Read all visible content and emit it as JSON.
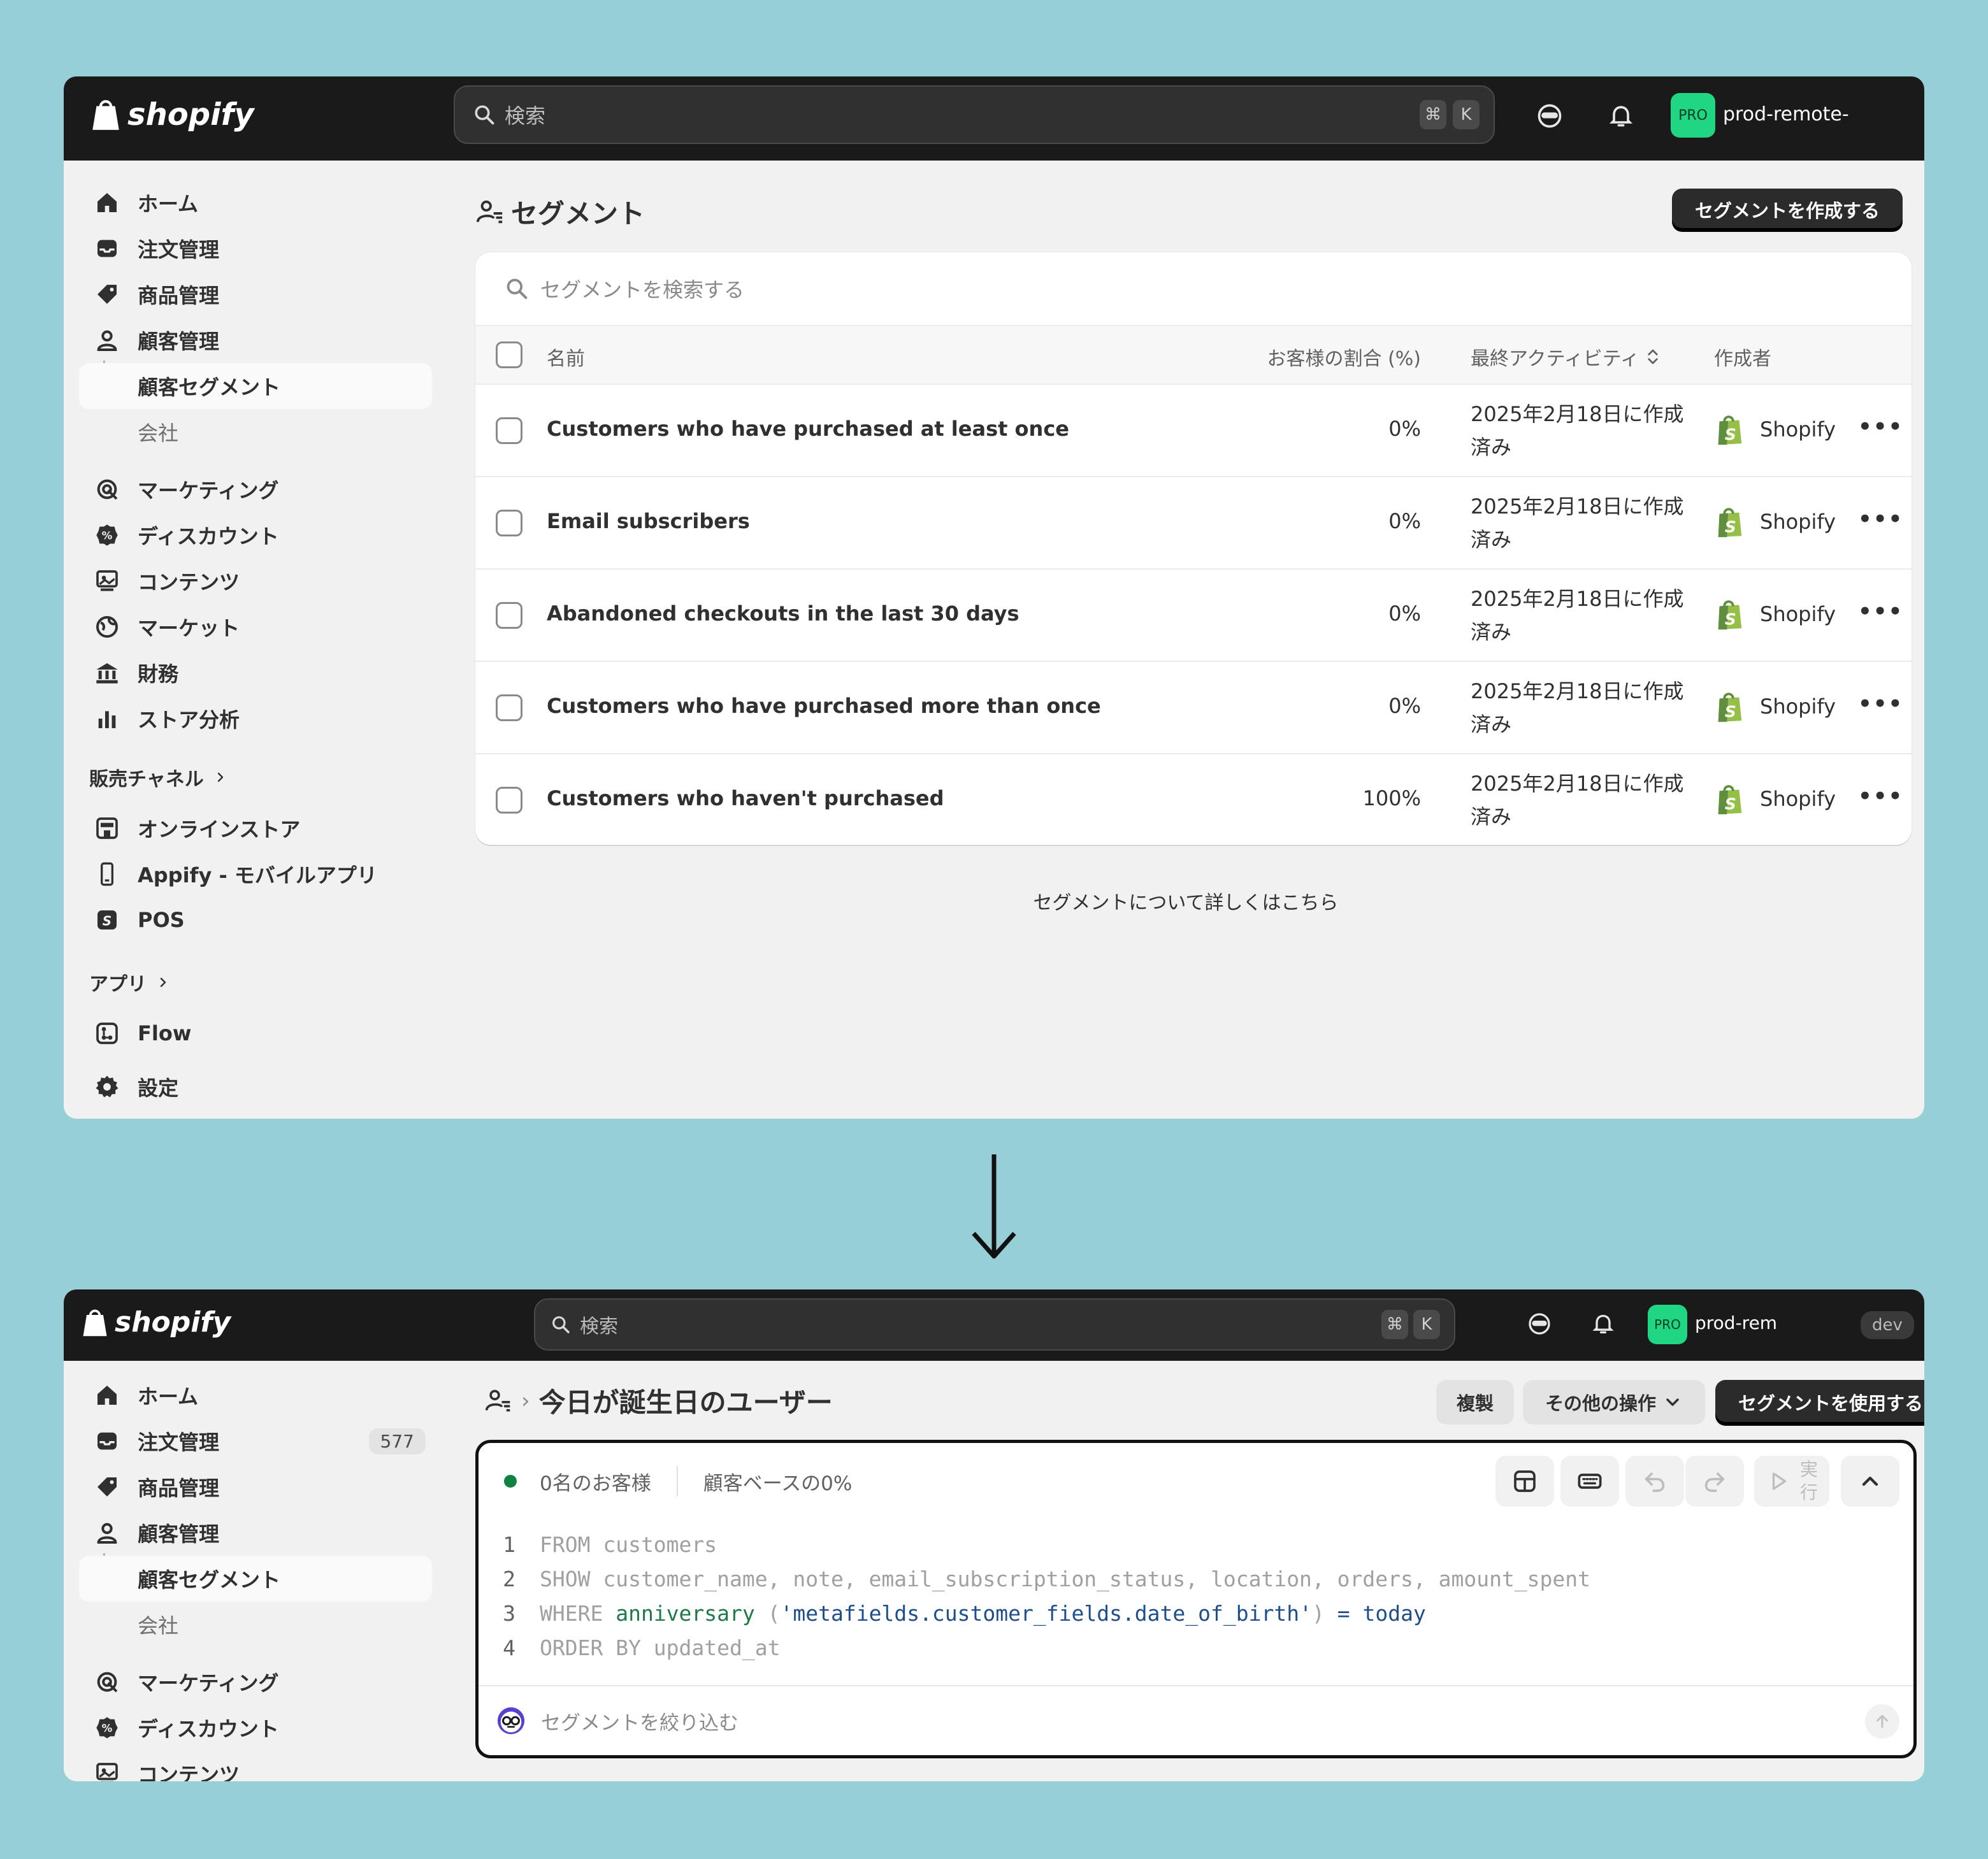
{
  "colors": {
    "page_bg": "#96d0d6",
    "topbar": "#1a1a1a",
    "accent_green": "#20d683",
    "shopify_green": "#95bf47",
    "status_green": "#108043"
  },
  "top": {
    "logo": "shopify",
    "search_placeholder": "検索",
    "kbd_cmd": "⌘",
    "kbd_k": "K",
    "avatar": "PRO",
    "store": "prod-remote-",
    "nav": [
      {
        "label": "ホーム",
        "icon": "home-icon"
      },
      {
        "label": "注文管理",
        "icon": "orders-icon"
      },
      {
        "label": "商品管理",
        "icon": "tag-icon"
      },
      {
        "label": "顧客管理",
        "icon": "person-icon"
      },
      {
        "label": "顧客セグメント"
      },
      {
        "label": "会社"
      },
      {
        "label": "マーケティング",
        "icon": "marketing-icon"
      },
      {
        "label": "ディスカウント",
        "icon": "discount-icon"
      },
      {
        "label": "コンテンツ",
        "icon": "content-icon"
      },
      {
        "label": "マーケット",
        "icon": "globe-icon"
      },
      {
        "label": "財務",
        "icon": "bank-icon"
      },
      {
        "label": "ストア分析",
        "icon": "chart-icon"
      }
    ],
    "sales_channels": "販売チャネル",
    "channels": [
      {
        "label": "オンラインストア",
        "icon": "store-icon"
      },
      {
        "label": "Appify - モバイルアプリ",
        "icon": "mobile-icon"
      },
      {
        "label": "POS",
        "icon": "pos-icon"
      }
    ],
    "apps": "アプリ",
    "app_items": [
      {
        "label": "Flow",
        "icon": "flow-icon"
      }
    ],
    "settings": "設定",
    "page_title": "セグメント",
    "create_button": "セグメントを作成する",
    "segment_search_placeholder": "セグメントを検索する",
    "columns": {
      "name": "名前",
      "share": "お客様の割合 (%)",
      "activity": "最終アクティビティ",
      "creator": "作成者"
    },
    "rows": [
      {
        "name": "Customers who have purchased at least once",
        "share": "0%",
        "activity": "2025年2月18日に作成済み",
        "creator": "Shopify"
      },
      {
        "name": "Email subscribers",
        "share": "0%",
        "activity": "2025年2月18日に作成済み",
        "creator": "Shopify"
      },
      {
        "name": "Abandoned checkouts in the last 30 days",
        "share": "0%",
        "activity": "2025年2月18日に作成済み",
        "creator": "Shopify"
      },
      {
        "name": "Customers who have purchased more than once",
        "share": "0%",
        "activity": "2025年2月18日に作成済み",
        "creator": "Shopify"
      },
      {
        "name": "Customers who haven't purchased",
        "share": "100%",
        "activity": "2025年2月18日に作成済み",
        "creator": "Shopify"
      }
    ],
    "more": "•••",
    "learn_more": "セグメントについて詳しくはこちら"
  },
  "bottom": {
    "logo": "shopify",
    "search_placeholder": "検索",
    "kbd_cmd": "⌘",
    "kbd_k": "K",
    "avatar": "PRO",
    "store": "prod-remote-",
    "dev": "dev",
    "nav": [
      {
        "label": "ホーム"
      },
      {
        "label": "注文管理",
        "badge": "577"
      },
      {
        "label": "商品管理"
      },
      {
        "label": "顧客管理"
      },
      {
        "label": "顧客セグメント"
      },
      {
        "label": "会社"
      },
      {
        "label": "マーケティング"
      },
      {
        "label": "ディスカウント"
      },
      {
        "label": "コンテンツ"
      }
    ],
    "breadcrumb_sep": "›",
    "page_title": "今日が誕生日のユーザー",
    "duplicate": "複製",
    "more_actions": "その他の操作",
    "use_segment": "セグメントを使用する",
    "customer_count": "0名のお客様",
    "customer_base": "顧客ベースの0%",
    "run_label": "実行",
    "code": [
      {
        "n": "1",
        "parts": [
          {
            "t": "FROM customers",
            "c": "kw"
          }
        ]
      },
      {
        "n": "2",
        "parts": [
          {
            "t": "SHOW customer_name, note, email_subscription_status, location, orders, amount_spent",
            "c": "kw"
          }
        ]
      },
      {
        "n": "3",
        "parts": [
          {
            "t": "WHERE ",
            "c": "kw"
          },
          {
            "t": "anniversary",
            "c": "gr"
          },
          {
            "t": " (",
            "c": "kw"
          },
          {
            "t": "'metafields.customer_fields.date_of_birth'",
            "c": "bl"
          },
          {
            "t": ") ",
            "c": "kw"
          },
          {
            "t": "=",
            "c": "bl"
          },
          {
            "t": " ",
            "c": "kw"
          },
          {
            "t": "today",
            "c": "bl"
          }
        ]
      },
      {
        "n": "4",
        "parts": [
          {
            "t": "ORDER BY updated_at",
            "c": "kw"
          }
        ]
      }
    ],
    "filter_placeholder": "セグメントを絞り込む"
  }
}
